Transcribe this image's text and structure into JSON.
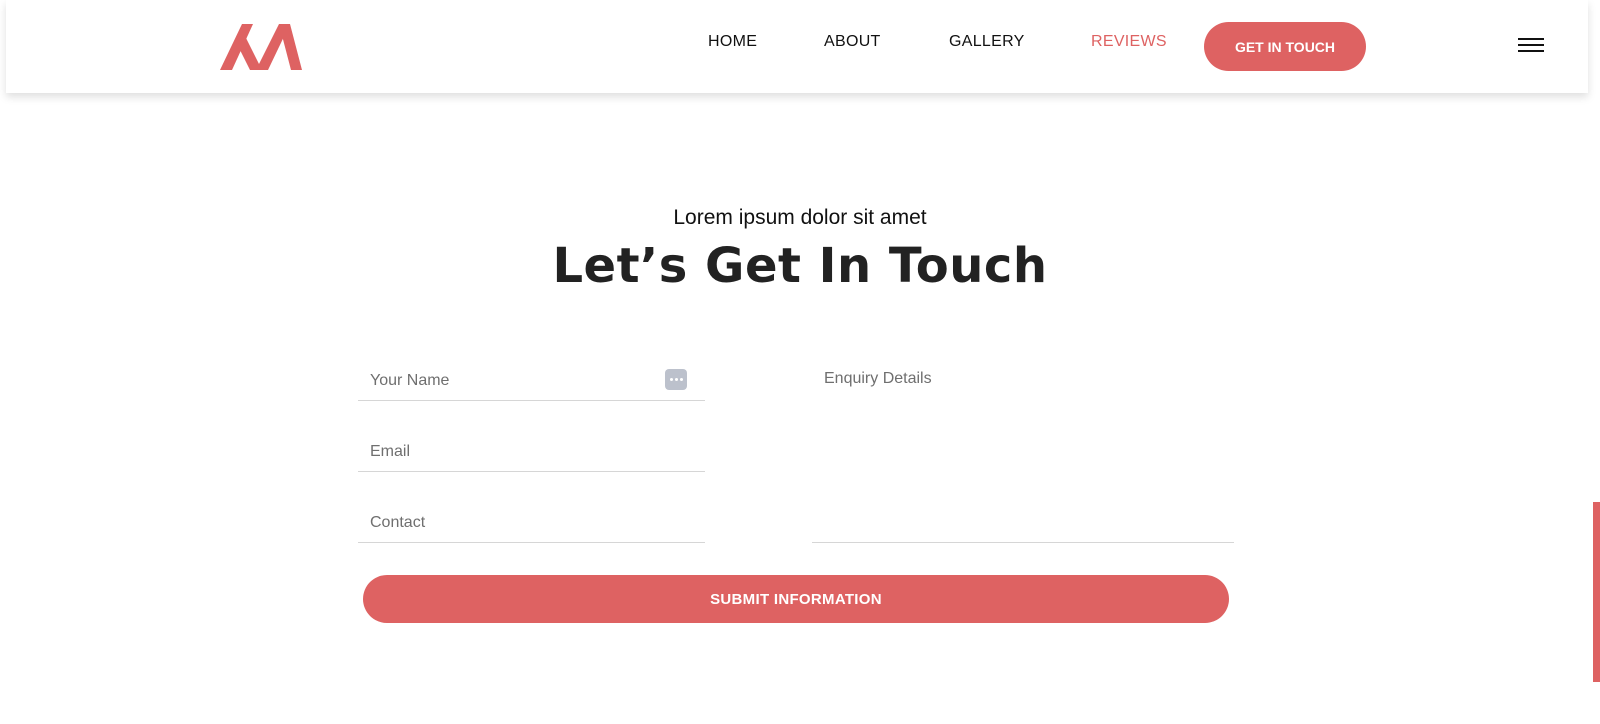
{
  "colors": {
    "accent": "#de6262",
    "text": "#222222",
    "divider": "#d6d6d6"
  },
  "nav": {
    "items": [
      {
        "label": "HOME"
      },
      {
        "label": "ABOUT"
      },
      {
        "label": "GALLERY"
      },
      {
        "label": "REVIEWS",
        "active": true
      }
    ],
    "cta_label": "GET IN TOUCH",
    "logo_icon": "logo-m-icon",
    "menu_icon": "hamburger-menu-icon"
  },
  "contact": {
    "subtitle": "Lorem ipsum dolor sit amet",
    "title": "Let’s Get In Touch",
    "fields": {
      "name_placeholder": "Your Name",
      "email_placeholder": "Email",
      "contact_placeholder": "Contact",
      "enquiry_placeholder": "Enquiry Details"
    },
    "autofill_icon": "autofill-dots-icon",
    "submit_label": "SUBMIT INFORMATION"
  }
}
